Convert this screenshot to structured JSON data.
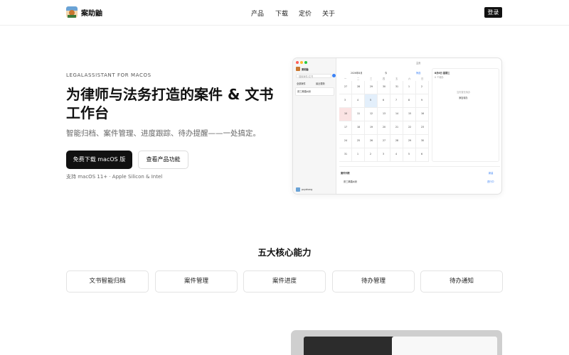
{
  "header": {
    "brand": "案助鼬",
    "nav": [
      "产品",
      "下载",
      "定价",
      "关于"
    ],
    "login": "登录"
  },
  "hero": {
    "kicker": "LEGALASSISTANT FOR MACOS",
    "title": "为律师与法务打造的案件 & 文书工作台",
    "subtitle": "智能归档、案件管理、进度跟踪、待办提醒——一处搞定。",
    "primary_button": "免费下载 macOS 版",
    "secondary_button": "查看产品功能",
    "support": "支持 macOS 11+ · Apple Silicon & Intel"
  },
  "mockup": {
    "sidebar_title": "案助鼬",
    "sidebar_search": "搜索案件/文书",
    "sidebar_tab_all": "全部案件",
    "sidebar_tab_recent": "最近更新",
    "case_item": "张三离婚纠纷",
    "user_name": "pzyzhang",
    "window_title": "主页",
    "month_label": "2026年8月",
    "today_label": "今",
    "filter_label": "筛选",
    "right_date": "8月6日 星期三",
    "right_sub": "0 个待办",
    "right_empty": "当天暂无待办",
    "right_button": "添加待办",
    "bottom_title": "案件列表",
    "bottom_button": "新建",
    "bottom_case": "张三离婚纠纷",
    "bottom_tag": "进行中",
    "weekdays": [
      "一",
      "二",
      "三",
      "四",
      "五",
      "六",
      "日"
    ],
    "calendar_days": [
      "27",
      "28",
      "29",
      "30",
      "31",
      "1",
      "2",
      "3",
      "4",
      "5",
      "6",
      "7",
      "8",
      "9",
      "10",
      "11",
      "12",
      "13",
      "14",
      "15",
      "16",
      "17",
      "18",
      "19",
      "20",
      "21",
      "22",
      "23",
      "24",
      "25",
      "26",
      "27",
      "28",
      "29",
      "30",
      "31",
      "1",
      "2",
      "3",
      "4",
      "5",
      "6"
    ]
  },
  "features": {
    "title": "五大核心能力",
    "items": [
      "文书智能归档",
      "案件管理",
      "案件进度",
      "待办管理",
      "待办通知"
    ]
  },
  "colors": {
    "accent": "#111111",
    "border": "#e3e3e3",
    "muted": "#666666"
  }
}
